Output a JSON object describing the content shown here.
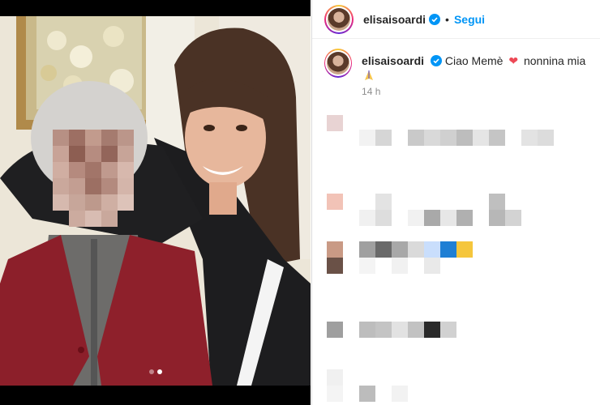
{
  "post": {
    "username": "elisaisoardi",
    "separator": "•",
    "follow_label": "Segui",
    "caption_prefix": "Ciao Memè",
    "caption_suffix": "nonnina mia",
    "timestamp": "14 h",
    "carousel_total": 2,
    "carousel_current": 2
  },
  "colors": {
    "follow_blue": "#0095f6",
    "heart_red": "#ed4956",
    "text": "#262626",
    "muted": "#8e8e8e"
  }
}
